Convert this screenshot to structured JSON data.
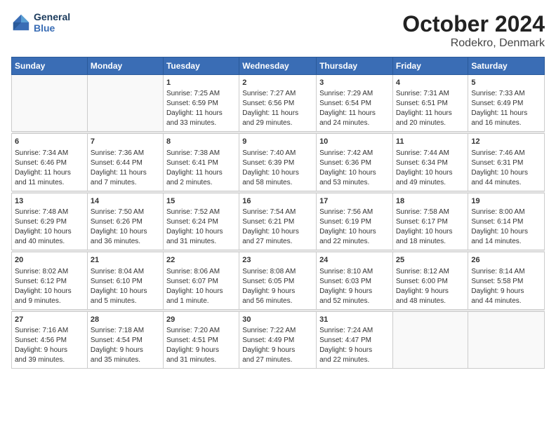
{
  "logo": {
    "line1": "General",
    "line2": "Blue"
  },
  "title": "October 2024",
  "subtitle": "Rodekro, Denmark",
  "days_header": [
    "Sunday",
    "Monday",
    "Tuesday",
    "Wednesday",
    "Thursday",
    "Friday",
    "Saturday"
  ],
  "weeks": [
    [
      {
        "num": "",
        "info": ""
      },
      {
        "num": "",
        "info": ""
      },
      {
        "num": "1",
        "info": "Sunrise: 7:25 AM\nSunset: 6:59 PM\nDaylight: 11 hours\nand 33 minutes."
      },
      {
        "num": "2",
        "info": "Sunrise: 7:27 AM\nSunset: 6:56 PM\nDaylight: 11 hours\nand 29 minutes."
      },
      {
        "num": "3",
        "info": "Sunrise: 7:29 AM\nSunset: 6:54 PM\nDaylight: 11 hours\nand 24 minutes."
      },
      {
        "num": "4",
        "info": "Sunrise: 7:31 AM\nSunset: 6:51 PM\nDaylight: 11 hours\nand 20 minutes."
      },
      {
        "num": "5",
        "info": "Sunrise: 7:33 AM\nSunset: 6:49 PM\nDaylight: 11 hours\nand 16 minutes."
      }
    ],
    [
      {
        "num": "6",
        "info": "Sunrise: 7:34 AM\nSunset: 6:46 PM\nDaylight: 11 hours\nand 11 minutes."
      },
      {
        "num": "7",
        "info": "Sunrise: 7:36 AM\nSunset: 6:44 PM\nDaylight: 11 hours\nand 7 minutes."
      },
      {
        "num": "8",
        "info": "Sunrise: 7:38 AM\nSunset: 6:41 PM\nDaylight: 11 hours\nand 2 minutes."
      },
      {
        "num": "9",
        "info": "Sunrise: 7:40 AM\nSunset: 6:39 PM\nDaylight: 10 hours\nand 58 minutes."
      },
      {
        "num": "10",
        "info": "Sunrise: 7:42 AM\nSunset: 6:36 PM\nDaylight: 10 hours\nand 53 minutes."
      },
      {
        "num": "11",
        "info": "Sunrise: 7:44 AM\nSunset: 6:34 PM\nDaylight: 10 hours\nand 49 minutes."
      },
      {
        "num": "12",
        "info": "Sunrise: 7:46 AM\nSunset: 6:31 PM\nDaylight: 10 hours\nand 44 minutes."
      }
    ],
    [
      {
        "num": "13",
        "info": "Sunrise: 7:48 AM\nSunset: 6:29 PM\nDaylight: 10 hours\nand 40 minutes."
      },
      {
        "num": "14",
        "info": "Sunrise: 7:50 AM\nSunset: 6:26 PM\nDaylight: 10 hours\nand 36 minutes."
      },
      {
        "num": "15",
        "info": "Sunrise: 7:52 AM\nSunset: 6:24 PM\nDaylight: 10 hours\nand 31 minutes."
      },
      {
        "num": "16",
        "info": "Sunrise: 7:54 AM\nSunset: 6:21 PM\nDaylight: 10 hours\nand 27 minutes."
      },
      {
        "num": "17",
        "info": "Sunrise: 7:56 AM\nSunset: 6:19 PM\nDaylight: 10 hours\nand 22 minutes."
      },
      {
        "num": "18",
        "info": "Sunrise: 7:58 AM\nSunset: 6:17 PM\nDaylight: 10 hours\nand 18 minutes."
      },
      {
        "num": "19",
        "info": "Sunrise: 8:00 AM\nSunset: 6:14 PM\nDaylight: 10 hours\nand 14 minutes."
      }
    ],
    [
      {
        "num": "20",
        "info": "Sunrise: 8:02 AM\nSunset: 6:12 PM\nDaylight: 10 hours\nand 9 minutes."
      },
      {
        "num": "21",
        "info": "Sunrise: 8:04 AM\nSunset: 6:10 PM\nDaylight: 10 hours\nand 5 minutes."
      },
      {
        "num": "22",
        "info": "Sunrise: 8:06 AM\nSunset: 6:07 PM\nDaylight: 10 hours\nand 1 minute."
      },
      {
        "num": "23",
        "info": "Sunrise: 8:08 AM\nSunset: 6:05 PM\nDaylight: 9 hours\nand 56 minutes."
      },
      {
        "num": "24",
        "info": "Sunrise: 8:10 AM\nSunset: 6:03 PM\nDaylight: 9 hours\nand 52 minutes."
      },
      {
        "num": "25",
        "info": "Sunrise: 8:12 AM\nSunset: 6:00 PM\nDaylight: 9 hours\nand 48 minutes."
      },
      {
        "num": "26",
        "info": "Sunrise: 8:14 AM\nSunset: 5:58 PM\nDaylight: 9 hours\nand 44 minutes."
      }
    ],
    [
      {
        "num": "27",
        "info": "Sunrise: 7:16 AM\nSunset: 4:56 PM\nDaylight: 9 hours\nand 39 minutes."
      },
      {
        "num": "28",
        "info": "Sunrise: 7:18 AM\nSunset: 4:54 PM\nDaylight: 9 hours\nand 35 minutes."
      },
      {
        "num": "29",
        "info": "Sunrise: 7:20 AM\nSunset: 4:51 PM\nDaylight: 9 hours\nand 31 minutes."
      },
      {
        "num": "30",
        "info": "Sunrise: 7:22 AM\nSunset: 4:49 PM\nDaylight: 9 hours\nand 27 minutes."
      },
      {
        "num": "31",
        "info": "Sunrise: 7:24 AM\nSunset: 4:47 PM\nDaylight: 9 hours\nand 22 minutes."
      },
      {
        "num": "",
        "info": ""
      },
      {
        "num": "",
        "info": ""
      }
    ]
  ]
}
